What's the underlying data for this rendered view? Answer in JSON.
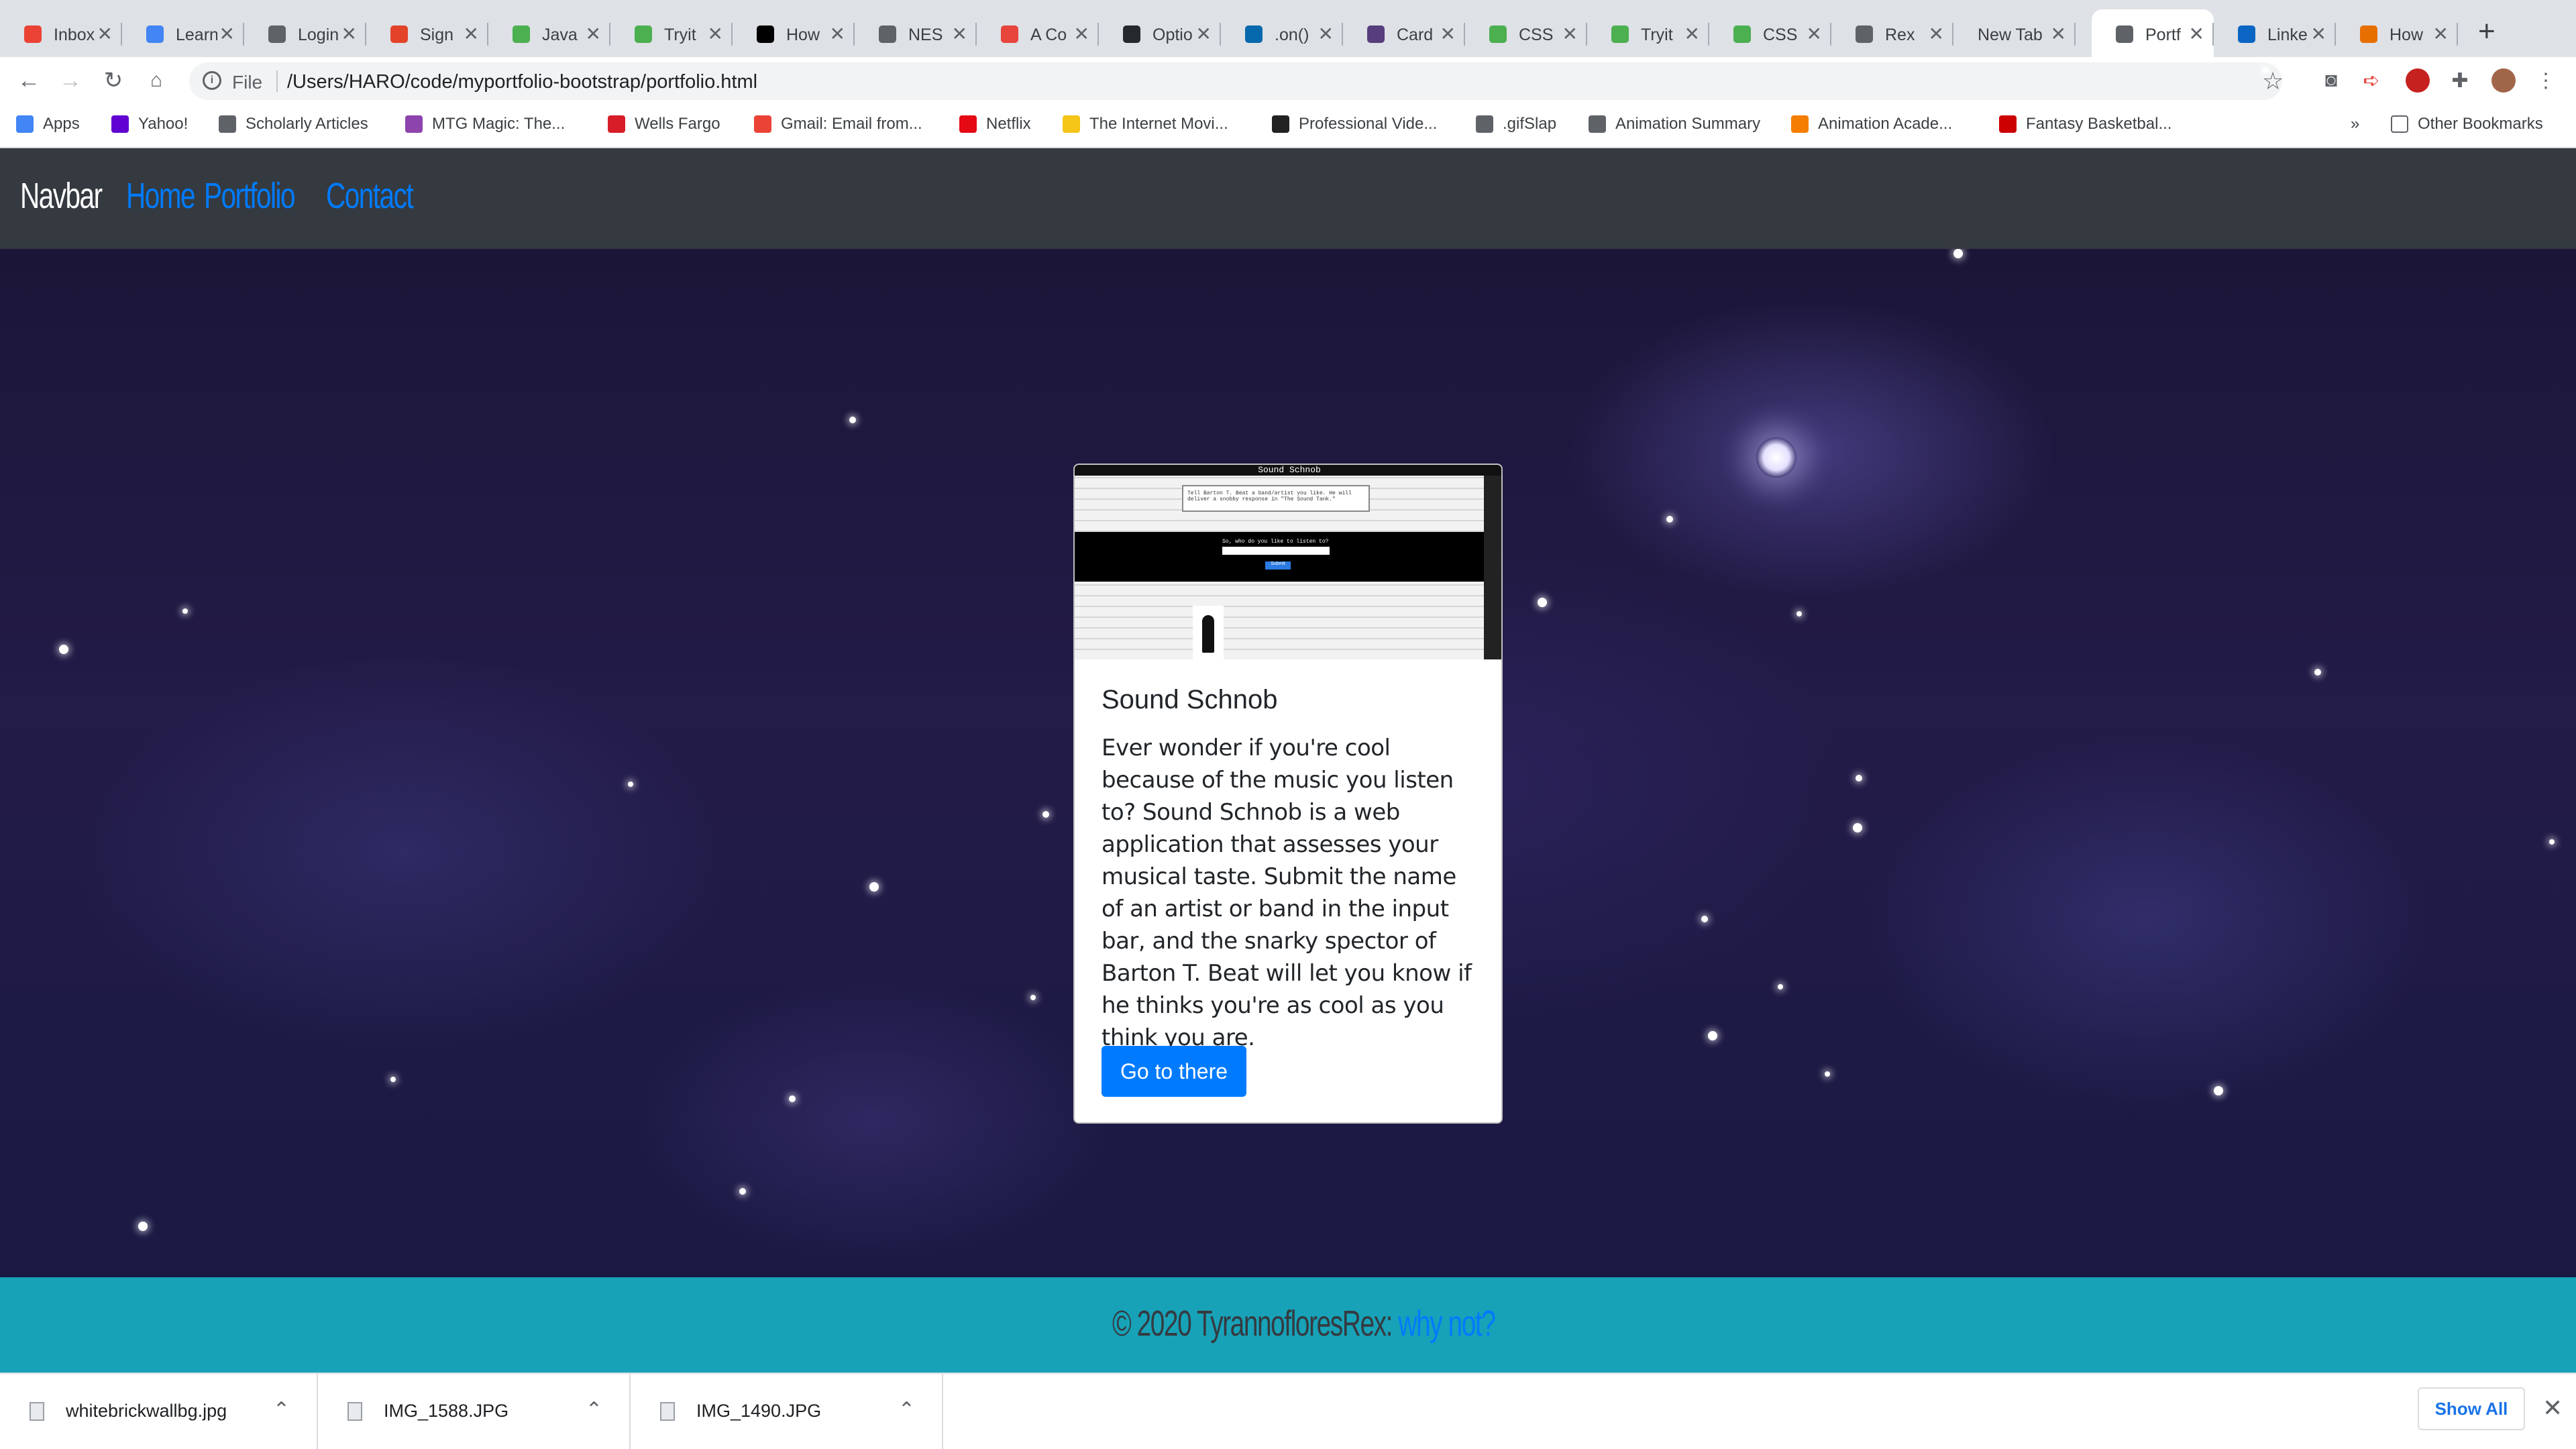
{
  "browser": {
    "tabs": [
      {
        "title": "Inbox",
        "favicon": "gmail-icon",
        "color": "#ea4335"
      },
      {
        "title": "Learn",
        "favicon": "chrome-icon",
        "color": "#4285f4"
      },
      {
        "title": "Login",
        "favicon": "globe-icon",
        "color": "#5f6368"
      },
      {
        "title": "Sign",
        "favicon": "gitlab-icon",
        "color": "#e24329"
      },
      {
        "title": "Java",
        "favicon": "w3schools-icon",
        "color": "#4caf50"
      },
      {
        "title": "Tryit",
        "favicon": "w3schools-icon",
        "color": "#4caf50"
      },
      {
        "title": "How",
        "favicon": "medium-icon",
        "color": "#000000"
      },
      {
        "title": "NES",
        "favicon": "cloud-icon",
        "color": "#5f6368"
      },
      {
        "title": "A Co",
        "favicon": "star-badge-icon",
        "color": "#e8453c"
      },
      {
        "title": "Optio",
        "favicon": "github-icon",
        "color": "#24292e"
      },
      {
        "title": ".on()",
        "favicon": "jquery-icon",
        "color": "#0769ad"
      },
      {
        "title": "Card",
        "favicon": "bootstrap-icon",
        "color": "#563d7c"
      },
      {
        "title": "CSS",
        "favicon": "w3schools-icon",
        "color": "#4caf50"
      },
      {
        "title": "Tryit",
        "favicon": "w3schools-icon",
        "color": "#4caf50"
      },
      {
        "title": "CSS",
        "favicon": "w3schools-icon",
        "color": "#4caf50"
      },
      {
        "title": "Rex",
        "favicon": "globe-icon",
        "color": "#5f6368"
      },
      {
        "title": "New Tab",
        "favicon": "",
        "color": ""
      },
      {
        "title": "Portf",
        "favicon": "globe-icon",
        "color": "#5f6368"
      },
      {
        "title": "Linke",
        "favicon": "linkedin-icon",
        "color": "#0a66c2"
      },
      {
        "title": "How",
        "favicon": "java-icon",
        "color": "#e76f00"
      }
    ],
    "active_tab_index": 17,
    "address_scheme": "File",
    "url": "/Users/HARO/code/myportfolio-bootstrap/portfolio.html",
    "bookmarks": [
      {
        "label": "Apps",
        "icon": "apps-grid-icon",
        "color": "#4285f4"
      },
      {
        "label": "Yahoo!",
        "icon": "yahoo-icon",
        "color": "#6001d2"
      },
      {
        "label": "Scholarly Articles",
        "icon": "folder-icon",
        "color": "#5f6368"
      },
      {
        "label": "MTG Magic: The...",
        "icon": "mtg-icon",
        "color": "#8e44ad"
      },
      {
        "label": "Wells Fargo",
        "icon": "wellsfargo-icon",
        "color": "#d71e28"
      },
      {
        "label": "Gmail: Email from...",
        "icon": "gmail-icon",
        "color": "#ea4335"
      },
      {
        "label": "Netflix",
        "icon": "netflix-icon",
        "color": "#e50914"
      },
      {
        "label": "The Internet Movi...",
        "icon": "imdb-icon",
        "color": "#f5c518"
      },
      {
        "label": "Professional Vide...",
        "icon": "tiktok-icon",
        "color": "#222222"
      },
      {
        "label": ".gifSlap",
        "icon": "globe-icon",
        "color": "#5f6368"
      },
      {
        "label": "Animation Summary",
        "icon": "globe-icon",
        "color": "#5f6368"
      },
      {
        "label": "Animation Acade...",
        "icon": "blogger-icon",
        "color": "#f57d00"
      },
      {
        "label": "Fantasy Basketbal...",
        "icon": "espn-icon",
        "color": "#cc0000"
      }
    ],
    "bookmarks_overflow": "»",
    "other_bookmarks": "Other Bookmarks"
  },
  "site": {
    "brand": "Navbar",
    "nav": [
      "Home",
      "Portfolio",
      "Contact"
    ],
    "card": {
      "title": "Sound Schnob",
      "text": "Ever wonder if you're cool because of the music you listen to? Sound Schnob is a web application that assesses your musical taste. Submit the name of an artist or band in the input bar, and the snarky spector of Barton T. Beat will let you know if he thinks you're as cool as you think you are.",
      "button": "Go to there",
      "thumb": {
        "title": "Sound Schnob",
        "bubble": "Tell Barton T. Beat a band/artist you like. He will deliver a snobby response in \"The Sound Tank.\"",
        "question": "So, who do you like to listen to?",
        "submit": "Submit"
      }
    },
    "footer": {
      "text": "© 2020 TyrannofloresRex: ",
      "link": "why not?"
    },
    "colors": {
      "navbar": "#343a40",
      "link": "#007bff",
      "footer": "#17a2b8",
      "button": "#007bff"
    }
  },
  "downloads": {
    "items": [
      "whitebrickwallbg.jpg",
      "IMG_1588.JPG",
      "IMG_1490.JPG"
    ],
    "show_all": "Show All"
  }
}
